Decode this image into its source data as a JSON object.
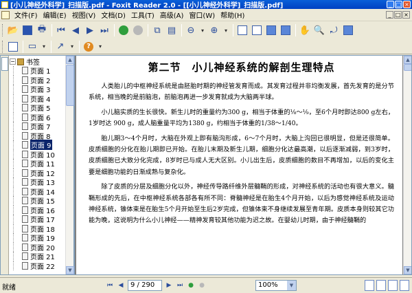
{
  "window": {
    "title": "[小儿神经外科学]_扫描版.pdf - Foxit Reader 2.0 - [[小儿神经外科学]_扫描版.pdf]"
  },
  "menu": {
    "items": [
      "文件(F)",
      "编辑(E)",
      "视图(V)",
      "文档(D)",
      "工具(T)",
      "高级(A)",
      "窗口(W)",
      "帮助(H)"
    ]
  },
  "toolbar1": {
    "icons": [
      "open-icon",
      "save-icon",
      "print-icon",
      "first-page-icon",
      "prev-page-icon",
      "next-page-icon",
      "last-page-icon",
      "go-forward-icon",
      "go-back-icon",
      "snapshot-icon",
      "select-text-icon",
      "zoom-out-icon",
      "zoom-in-icon",
      "single-page-icon",
      "continuous-icon",
      "facing-icon",
      "hand-tool-icon",
      "zoom-tool-icon",
      "rotate-icon",
      "image-icon"
    ]
  },
  "toolbar2": {
    "icons": [
      "bookmark-panel-icon",
      "annotation-icon",
      "arrow-tool-icon",
      "help-icon"
    ]
  },
  "bookmarks": {
    "root_label": "书签",
    "items": [
      "页面 1",
      "页面 2",
      "页面 3",
      "页面 4",
      "页面 5",
      "页面 6",
      "页面 7",
      "页面 8",
      "页面 9",
      "页面 10",
      "页面 11",
      "页面 12",
      "页面 13",
      "页面 14",
      "页面 15",
      "页面 16",
      "页面 17",
      "页面 18",
      "页面 19",
      "页面 20",
      "页面 21",
      "页面 22"
    ],
    "selected": "页面 9"
  },
  "document": {
    "heading": "第二节　小儿神经系统的解剖生理特点",
    "paragraphs": [
      "人类胎儿的中枢神经系统是由胚胎时期的神经管发育而成。其发育过程并非均衡发展，首先发育的是分节系统，相当晚的是前脑泡，前脑泡再进一步发育就成为大脑两半球。",
      "小儿脑实质的生长很快。新生儿时的重量约为300 g，相当于体重的⅛～⅑，至6个月时即达800 g左右，1岁时达 900 g，成人脑重量平均为1380 g，约相当于体重的1/38～1/40。",
      "胎儿期3～4个月时，大脑在外观上即有脑沟形成，6～7个月时，大脑上沟回已很明显，但是还很简单。皮质细胞的分化在胎儿期即已开始。在胎儿末期及新生儿期，细胞分化达最高潮，以后逐渐减弱，到3岁时，皮质细胞已大致分化完成，8岁时已与成人无大区别。小儿出生后，皮质细胞的数目不再增加，以后的变化主要是细胞功能的日渐成熟与复杂化。",
      "除了皮质的分层及细胞分化以外，神经传导路纤维外层髓鞘的形成，对神经系统的活动也有很大意义。髓鞘形成的先后，在中枢神经系统各部各有所不同：脊髓神经是在胎生4个月开始，以后为感觉神经系统及运动神经系统，锥体束是在胎生5个月开始至生后2岁完成，但锥体束不身继续发展至青年期。皮质本身则较其它功能为晚，这说明为什么小儿神经——精神发育较其他功能为迟之故。在婴幼儿时期，由于神经髓鞘的"
    ]
  },
  "status": {
    "text": "就绪",
    "page_indicator": "9 / 290",
    "zoom": "100%"
  }
}
